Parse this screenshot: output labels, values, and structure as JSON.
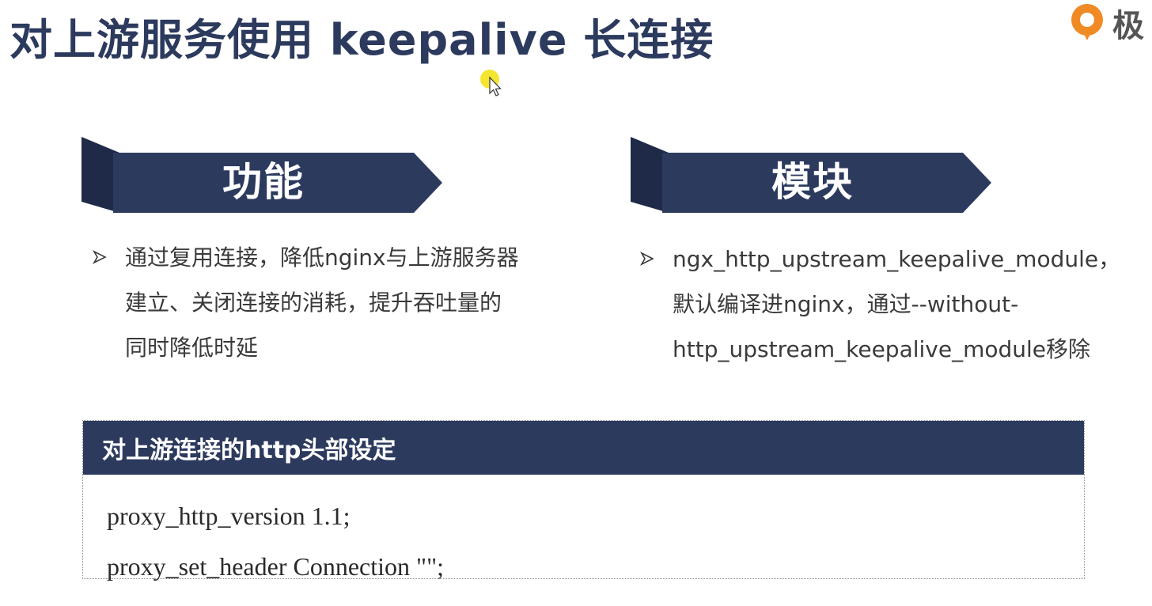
{
  "slide": {
    "title": "对上游服务使用 keepalive 长连接",
    "logo_text": "极"
  },
  "function_panel": {
    "heading": "功能",
    "lines": [
      "通过复用连接，降低nginx与上游服务器",
      "建立、关闭连接的消耗，提升吞吐量的",
      "同时降低时延"
    ]
  },
  "module_panel": {
    "heading": "模块",
    "lines": [
      "ngx_http_upstream_keepalive_module，",
      "默认编译进nginx，通过--without-",
      "http_upstream_keepalive_module移除"
    ]
  },
  "header_settings": {
    "heading": "对上游连接的http头部设定",
    "code_lines": [
      "proxy_http_version 1.1;",
      "proxy_set_header Connection \"\";"
    ]
  },
  "colors": {
    "navy": "#2c3a5e",
    "navy_dark": "#1e2a48",
    "logo_orange": "#f08a24",
    "cursor_highlight": "#f2e21a"
  },
  "icons": {
    "bullet": "▶",
    "logo": "geekbang-logo-icon",
    "cursor": "mouse-pointer-icon"
  }
}
